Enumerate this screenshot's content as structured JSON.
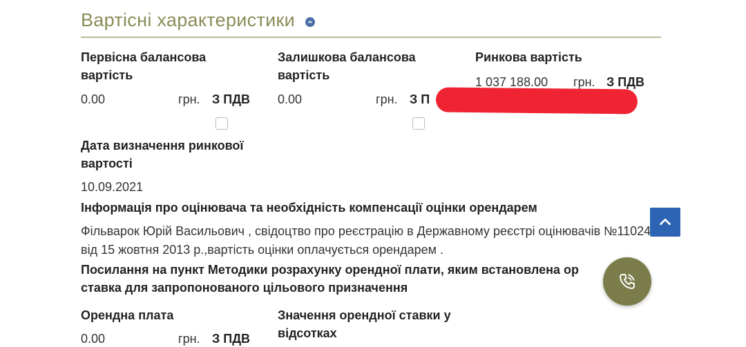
{
  "section": {
    "title": "Вартісні характеристики"
  },
  "fields": {
    "initial": {
      "label": "Первісна балансова вартість",
      "value": "0.00",
      "unit": "грн.",
      "vat": "З ПДВ"
    },
    "residual": {
      "label": "Залишкова балансова вартість",
      "value": "0.00",
      "unit": "грн.",
      "vat": "З П"
    },
    "market": {
      "label": "Ринкова вартість",
      "value": "1 037 188.00",
      "unit": "грн.",
      "vat": "З ПДВ"
    },
    "market_date": {
      "label": "Дата визначення ринкової вартості",
      "value": "10.09.2021"
    }
  },
  "appraiser": {
    "label": "Інформація про оцінювача та необхідність компенсації оцінки орендарем",
    "text": "Фільварок Юрій Васильович , свідоцтво про реєстрацію в Державному реєстрі оцінювачів №11024 від 15 жовтня 2013 р.,вартість оцінки оплачується орендарем ."
  },
  "methodology": {
    "label": "Посилання на пункт Методики розрахунку орендної плати, яким встановлена ор ставка для запропонованого цільового призначення"
  },
  "rent": {
    "label": "Орендна плата",
    "value": "0.00",
    "unit": "грн.",
    "vat": "З ПДВ",
    "rate_label": "Значення орендної ставки у відсотках"
  },
  "colors": {
    "title": "#8a8d57",
    "scroll_button": "#2d64b4",
    "call_button": "#7a7d4a",
    "redaction": "#f02333"
  },
  "icons": {
    "collapse": "chevron-up-icon",
    "scroll": "chevron-up-icon",
    "call": "phone-icon"
  }
}
